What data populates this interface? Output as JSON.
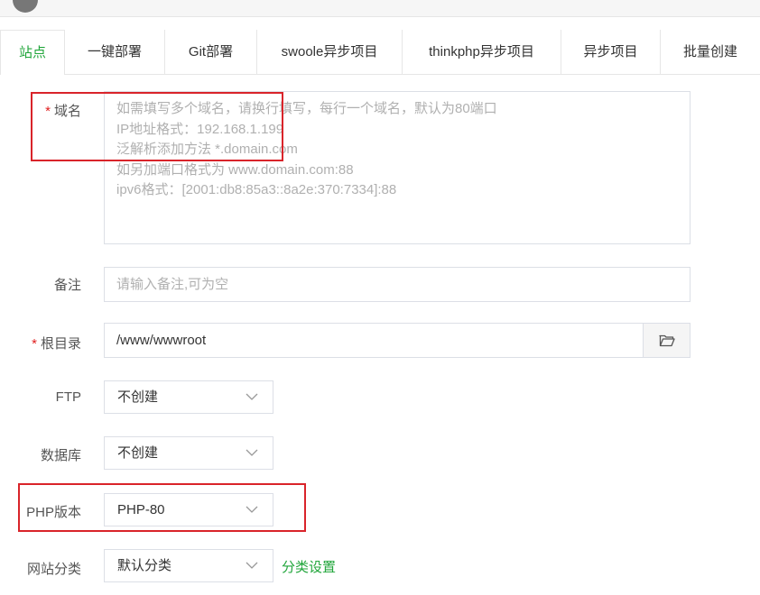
{
  "tabs": [
    {
      "label": "站点"
    },
    {
      "label": "一键部署"
    },
    {
      "label": "Git部署"
    },
    {
      "label": "swoole异步项目"
    },
    {
      "label": "thinkphp异步项目"
    },
    {
      "label": "异步项目"
    },
    {
      "label": "批量创建"
    }
  ],
  "form": {
    "required_mark": "*",
    "domain": {
      "label": "域名",
      "placeholder": "如需填写多个域名，请换行填写，每行一个域名，默认为80端口\nIP地址格式：192.168.1.199\n泛解析添加方法 *.domain.com\n如另加端口格式为 www.domain.com:88\nipv6格式：[2001:db8:85a3::8a2e:370:7334]:88"
    },
    "remark": {
      "label": "备注",
      "placeholder": "请输入备注,可为空"
    },
    "root": {
      "label": "根目录",
      "value": "/www/wwwroot",
      "icon": "folder-icon"
    },
    "ftp": {
      "label": "FTP",
      "selected": "不创建"
    },
    "database": {
      "label": "数据库",
      "selected": "不创建"
    },
    "php": {
      "label": "PHP版本",
      "selected": "PHP-80"
    },
    "category": {
      "label": "网站分类",
      "selected": "默认分类",
      "link": "分类设置"
    }
  },
  "colors": {
    "accent": "#20a53a",
    "highlight": "#d9242a",
    "required": "#e02020"
  }
}
